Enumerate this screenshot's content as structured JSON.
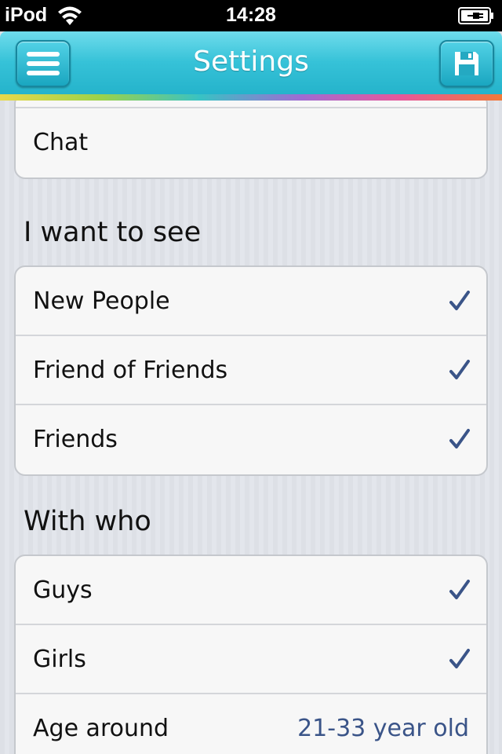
{
  "status_bar": {
    "carrier": "iPod",
    "time": "14:28"
  },
  "header": {
    "title": "Settings",
    "menu_icon": "hamburger-menu-icon",
    "save_icon": "floppy-disk-icon",
    "accent_color": "#36c2d8"
  },
  "top_group": {
    "items": [
      {
        "label": "Chat"
      }
    ]
  },
  "sections": [
    {
      "title": "I want to see",
      "items": [
        {
          "label": "New People",
          "checked": true
        },
        {
          "label": "Friend of Friends",
          "checked": true
        },
        {
          "label": "Friends",
          "checked": true
        }
      ]
    },
    {
      "title": "With who",
      "items": [
        {
          "label": "Guys",
          "checked": true
        },
        {
          "label": "Girls",
          "checked": true
        },
        {
          "label": "Age around",
          "value": "21-33 year old"
        }
      ]
    }
  ],
  "colors": {
    "check": "#3a5488",
    "value_text": "#3a5488"
  }
}
